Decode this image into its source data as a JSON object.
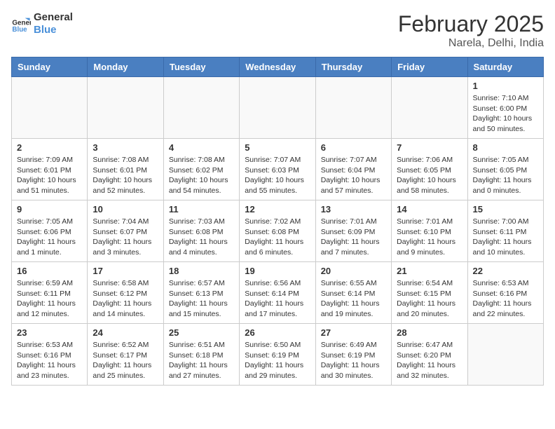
{
  "header": {
    "logo_line1": "General",
    "logo_line2": "Blue",
    "title": "February 2025",
    "subtitle": "Narela, Delhi, India"
  },
  "weekdays": [
    "Sunday",
    "Monday",
    "Tuesday",
    "Wednesday",
    "Thursday",
    "Friday",
    "Saturday"
  ],
  "weeks": [
    [
      {
        "day": "",
        "info": ""
      },
      {
        "day": "",
        "info": ""
      },
      {
        "day": "",
        "info": ""
      },
      {
        "day": "",
        "info": ""
      },
      {
        "day": "",
        "info": ""
      },
      {
        "day": "",
        "info": ""
      },
      {
        "day": "1",
        "info": "Sunrise: 7:10 AM\nSunset: 6:00 PM\nDaylight: 10 hours and 50 minutes."
      }
    ],
    [
      {
        "day": "2",
        "info": "Sunrise: 7:09 AM\nSunset: 6:01 PM\nDaylight: 10 hours and 51 minutes."
      },
      {
        "day": "3",
        "info": "Sunrise: 7:08 AM\nSunset: 6:01 PM\nDaylight: 10 hours and 52 minutes."
      },
      {
        "day": "4",
        "info": "Sunrise: 7:08 AM\nSunset: 6:02 PM\nDaylight: 10 hours and 54 minutes."
      },
      {
        "day": "5",
        "info": "Sunrise: 7:07 AM\nSunset: 6:03 PM\nDaylight: 10 hours and 55 minutes."
      },
      {
        "day": "6",
        "info": "Sunrise: 7:07 AM\nSunset: 6:04 PM\nDaylight: 10 hours and 57 minutes."
      },
      {
        "day": "7",
        "info": "Sunrise: 7:06 AM\nSunset: 6:05 PM\nDaylight: 10 hours and 58 minutes."
      },
      {
        "day": "8",
        "info": "Sunrise: 7:05 AM\nSunset: 6:05 PM\nDaylight: 11 hours and 0 minutes."
      }
    ],
    [
      {
        "day": "9",
        "info": "Sunrise: 7:05 AM\nSunset: 6:06 PM\nDaylight: 11 hours and 1 minute."
      },
      {
        "day": "10",
        "info": "Sunrise: 7:04 AM\nSunset: 6:07 PM\nDaylight: 11 hours and 3 minutes."
      },
      {
        "day": "11",
        "info": "Sunrise: 7:03 AM\nSunset: 6:08 PM\nDaylight: 11 hours and 4 minutes."
      },
      {
        "day": "12",
        "info": "Sunrise: 7:02 AM\nSunset: 6:08 PM\nDaylight: 11 hours and 6 minutes."
      },
      {
        "day": "13",
        "info": "Sunrise: 7:01 AM\nSunset: 6:09 PM\nDaylight: 11 hours and 7 minutes."
      },
      {
        "day": "14",
        "info": "Sunrise: 7:01 AM\nSunset: 6:10 PM\nDaylight: 11 hours and 9 minutes."
      },
      {
        "day": "15",
        "info": "Sunrise: 7:00 AM\nSunset: 6:11 PM\nDaylight: 11 hours and 10 minutes."
      }
    ],
    [
      {
        "day": "16",
        "info": "Sunrise: 6:59 AM\nSunset: 6:11 PM\nDaylight: 11 hours and 12 minutes."
      },
      {
        "day": "17",
        "info": "Sunrise: 6:58 AM\nSunset: 6:12 PM\nDaylight: 11 hours and 14 minutes."
      },
      {
        "day": "18",
        "info": "Sunrise: 6:57 AM\nSunset: 6:13 PM\nDaylight: 11 hours and 15 minutes."
      },
      {
        "day": "19",
        "info": "Sunrise: 6:56 AM\nSunset: 6:14 PM\nDaylight: 11 hours and 17 minutes."
      },
      {
        "day": "20",
        "info": "Sunrise: 6:55 AM\nSunset: 6:14 PM\nDaylight: 11 hours and 19 minutes."
      },
      {
        "day": "21",
        "info": "Sunrise: 6:54 AM\nSunset: 6:15 PM\nDaylight: 11 hours and 20 minutes."
      },
      {
        "day": "22",
        "info": "Sunrise: 6:53 AM\nSunset: 6:16 PM\nDaylight: 11 hours and 22 minutes."
      }
    ],
    [
      {
        "day": "23",
        "info": "Sunrise: 6:53 AM\nSunset: 6:16 PM\nDaylight: 11 hours and 23 minutes."
      },
      {
        "day": "24",
        "info": "Sunrise: 6:52 AM\nSunset: 6:17 PM\nDaylight: 11 hours and 25 minutes."
      },
      {
        "day": "25",
        "info": "Sunrise: 6:51 AM\nSunset: 6:18 PM\nDaylight: 11 hours and 27 minutes."
      },
      {
        "day": "26",
        "info": "Sunrise: 6:50 AM\nSunset: 6:19 PM\nDaylight: 11 hours and 29 minutes."
      },
      {
        "day": "27",
        "info": "Sunrise: 6:49 AM\nSunset: 6:19 PM\nDaylight: 11 hours and 30 minutes."
      },
      {
        "day": "28",
        "info": "Sunrise: 6:47 AM\nSunset: 6:20 PM\nDaylight: 11 hours and 32 minutes."
      },
      {
        "day": "",
        "info": ""
      }
    ]
  ]
}
